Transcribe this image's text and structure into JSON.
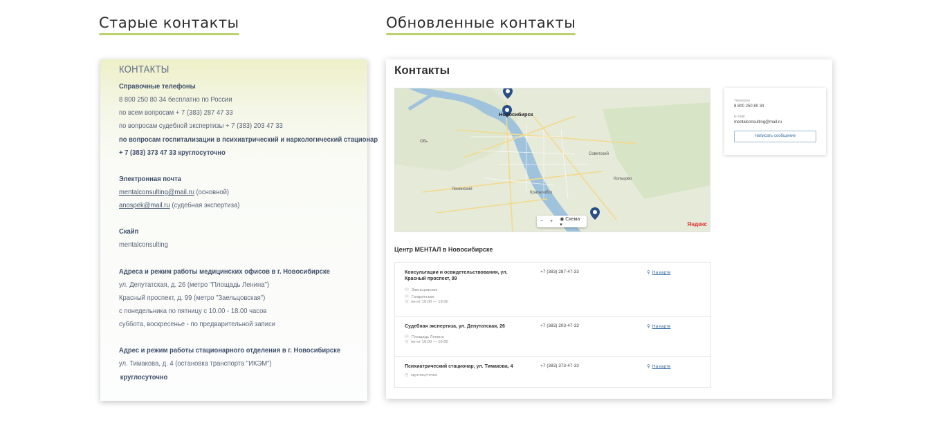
{
  "headings": {
    "old": "Старые контакты",
    "new": "Обновленные контакты"
  },
  "colors": {
    "underline": "#b9d36e",
    "old_text": "#3f4f6b",
    "link": "#3a6ea5"
  },
  "old": {
    "title": "КОНТАКТЫ",
    "phones_title": "Справочные телефоны",
    "phone1": "8 800 250 80 34 бесплатно по России",
    "phone2": "по всем вопросам + 7 (383) 287 47 33",
    "phone3": "по вопросам судебной экспертизы + 7 (383) 203 47 33",
    "phone4": "по вопросам госпитализации в психиатрический и наркологический стационар",
    "phone5": "+ 7 (383) 373 47 33 круглосуточно",
    "email_title": "Электронная почта",
    "email1": "mentalconsulting@mail.ru",
    "email1_note": "(основной)",
    "email2": "anospek@mail.ru",
    "email2_note": "(судебная экспертиза)",
    "skype_title": "Скайп",
    "skype": "mentalconsulting",
    "offices_title": "Адреса и режим работы медицинских офисов в г. Новосибирске",
    "office1": "ул. Депутатская, д. 26 (метро \"Площадь Ленина\")",
    "office2": "Красный проспект, д. 99 (метро \"Заельцовская\")",
    "office3": "с понедельника по пятницу с 10.00 - 18.00 часов",
    "office4": "суббота, воскресенье - по предварительной записи",
    "stac_title": "Адрес и режим работы стационарного отделения в г. Новосибирске",
    "stac1": "ул. Тимакова, д. 4 (остановка транспорта \"ИКЭМ\")",
    "stac2": "круглосуточно"
  },
  "new": {
    "title": "Контакты",
    "map": {
      "city": "Новосибирск",
      "scheme": "Схема",
      "zoom_out": "−",
      "zoom_in": "+",
      "logo": "Яндекс",
      "places": [
        "Обь",
        "Кольцово",
        "Краснообск",
        "Советский",
        "Ленинский"
      ]
    },
    "side": {
      "phone_label": "Телефон",
      "phone": "8 800 250 80 34",
      "email_label": "E-mail",
      "email": "mentalconsulting@mail.ru",
      "button": "Написать сообщение"
    },
    "center_title": "Центр МЕНТАЛ в Новосибирске",
    "rows": [
      {
        "name": "Консультации и освидетельствования, ул. Красный проспект, 99",
        "phone": "+7 (383) 287-47-33",
        "map": "На карте",
        "d1": "Заельцовская",
        "d2": "Гагаринская",
        "d3": "пн-пт 10:00 — 19:00"
      },
      {
        "name": "Судебная экспертиза, ул. Депутатская, 26",
        "phone": "+7 (383) 203-47-33",
        "map": "На карте",
        "d1": "Площадь Ленина",
        "d2": "пн-пт 10:00 — 19:00"
      },
      {
        "name": "Психиатрический стационар, ул. Тимакова, 4",
        "phone": "+7 (383) 373-47-33",
        "map": "На карте",
        "d1": "круглосуточно"
      }
    ]
  }
}
